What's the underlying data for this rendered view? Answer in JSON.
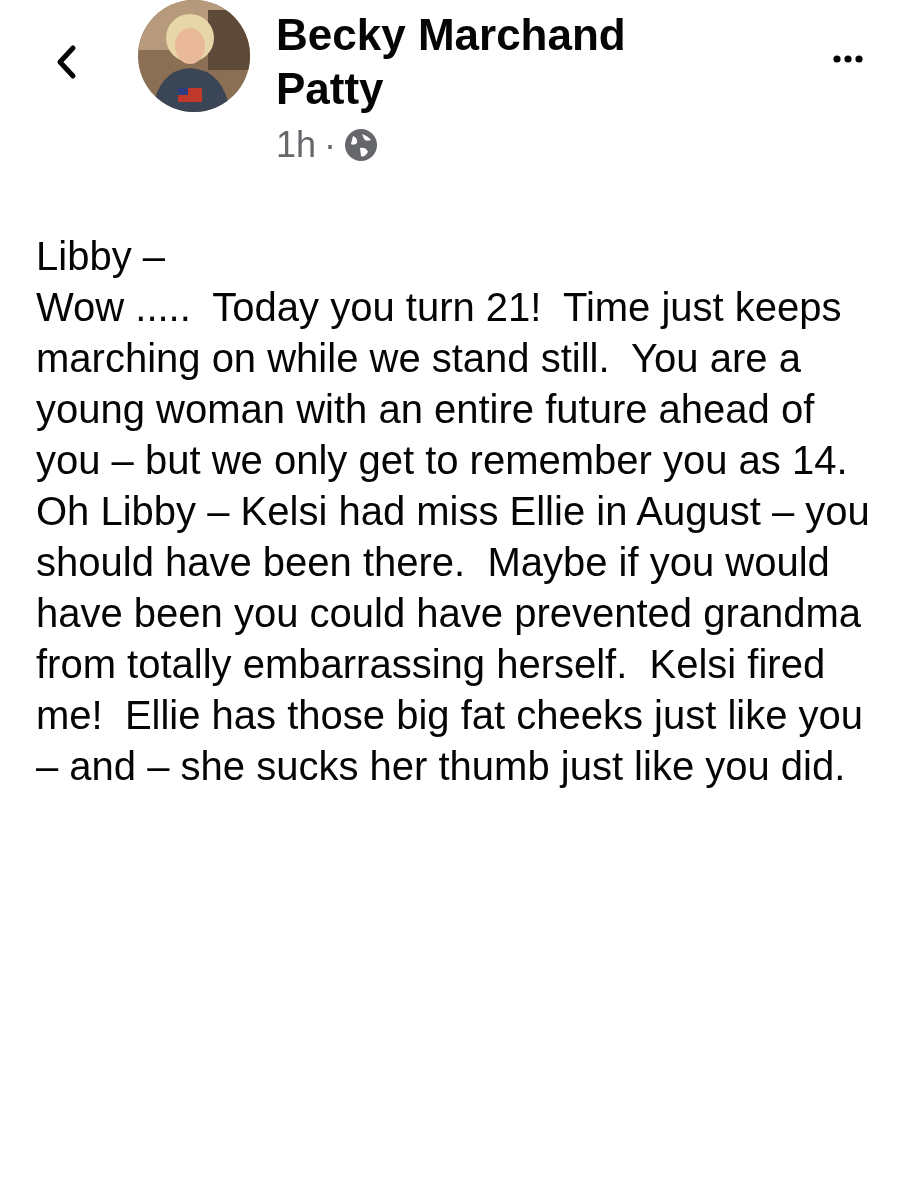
{
  "header": {
    "author": "Becky Marchand Patty",
    "time": "1h",
    "separator": "·"
  },
  "post": {
    "greeting": "Libby –",
    "body": "Wow .....  Today you turn 21!  Time just keeps marching on while we stand still.  You are a young woman with an entire future ahead of you – but we only get to remember you as 14.  Oh Libby – Kelsi had miss Ellie in August – you should have been there.  Maybe if you would have been you could have prevented grandma from totally embarrassing herself.  Kelsi fired me!  Ellie has those big fat cheeks just like you – and – she sucks her thumb just like you did."
  }
}
